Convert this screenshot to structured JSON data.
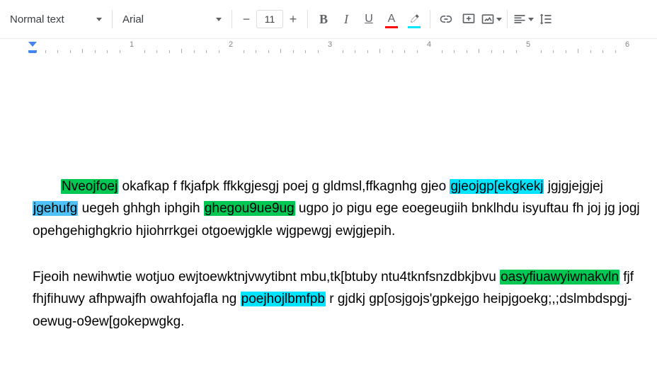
{
  "toolbar": {
    "styleLabel": "Normal text",
    "fontLabel": "Arial",
    "fontSize": "11",
    "textColorBar": "#ff0000",
    "highlightColorBar": "#00e5ff"
  },
  "ruler": {
    "numbers": [
      "1",
      "2",
      "3",
      "4",
      "5",
      "6"
    ]
  },
  "highlightColors": {
    "green": "#00c853",
    "cyan": "#00e5ff",
    "blue": "#4fc3f7"
  },
  "doc": {
    "p1": {
      "s1_hl": "Nveojfoej",
      "s2": "  okafkap f fkjafpk ffkkgjesgj poej g gldmsl,ffkagnhg gjeo ",
      "s3_hl": "gjeojgp[ekgkekj",
      "s4": " jgjgjejgjej ",
      "s5_hl": "jgehufg",
      "s6": " uegeh ghhgh iphgih ",
      "s7_hl": "ghegou9ue9ug",
      "s8": " ugpo jo pigu ege  eoegeugiih bnklhdu isyuftau fh joj jg  jogj opehgehighgkrio hjiohrrkgei otgoewjgkle wjgpewgj ewjgjepih."
    },
    "p2": {
      "s1": "Fjeoih newihwtie wotjuo ewjtoewktnjvwytibnt  mbu,tk[btuby ntu4tknfsnzdbkjbvu ",
      "s2_hl": "oasyfiuawyiwnakvln",
      "s3": " fjf fhjfihuwy  afhpwajfh owahfojafla ng ",
      "s4_hl": "poejhojlbmfpb",
      "s5": " r gjdkj gp[osjgojs'gpkejgo heipjgoekg;,;dslmbdspgj-oewug-o9ew[gokepwgkg."
    }
  }
}
